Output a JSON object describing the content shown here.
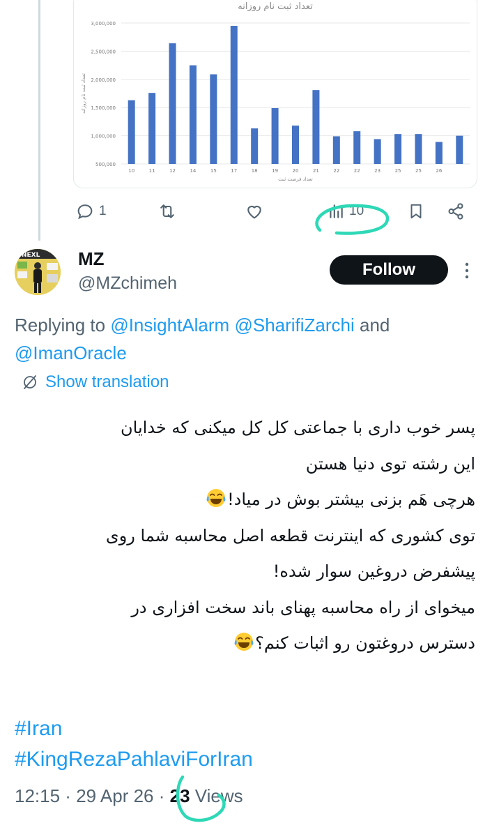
{
  "chart_data": {
    "type": "bar",
    "title": "تعداد ثبت نام روزانه",
    "xlabel": "تعداد فرصت ثبت",
    "ylabel": "تعداد ثبت نام روزانه",
    "categories": [
      "10",
      "11",
      "12",
      "14",
      "15",
      "17",
      "18",
      "19",
      "20",
      "21",
      "22",
      "22",
      "23",
      "25",
      "25",
      "26"
    ],
    "values": [
      1630000,
      1760000,
      2640000,
      2250000,
      2090000,
      2950000,
      1130000,
      1490000,
      1180000,
      1810000,
      990000,
      1080000,
      940000,
      1030000,
      1030000,
      890000,
      1000000
    ],
    "yticks": [
      "3,000,000",
      "2,500,000",
      "2,000,000",
      "1,500,000",
      "1,000,000",
      "500,000"
    ],
    "ylim": [
      500000,
      3000000
    ],
    "bar_color": "#4472c4",
    "grid": true
  },
  "actions": {
    "reply_count": "1",
    "views_count": "10"
  },
  "user": {
    "name": "MZ",
    "handle": "@MZchimeh"
  },
  "follow_label": "Follow",
  "replying": {
    "prefix": "Replying to ",
    "mention1": "@InsightAlarm",
    "mention2": "@SharifiZarchi",
    "and": " and ",
    "mention3": "@ImanOracle"
  },
  "show_translation": "Show translation",
  "tweet_lines": [
    "پسر خوب داری با جماعتی کل کل میکنی که خدایان",
    "این رشته توی دنیا هستن",
    "هرچی هَم بزنی بیشتر بوش در میاد!",
    "توی کشوری که اینترنت قطعه اصل محاسبه شما روی",
    "پیشفرض دروغین سوار شده!",
    "میخوای از راه محاسبه پهنای باند سخت افزاری در",
    "دسترس دروغتون رو اثبات کنم؟"
  ],
  "hashtags": [
    "#Iran",
    "#KingRezaPahlaviForIran"
  ],
  "meta": {
    "time": "12:15",
    "date": "29 Apr 26",
    "views_num": "23",
    "views_label": "Views"
  },
  "colors": {
    "link": "#1d9bf0",
    "muted": "#536471",
    "marker": "#2ed8b6"
  },
  "icons": [
    "reply-icon",
    "retweet-icon",
    "like-icon",
    "views-icon",
    "bookmark-icon",
    "share-icon",
    "more-icon",
    "translate-icon",
    "laugh-emoji"
  ]
}
